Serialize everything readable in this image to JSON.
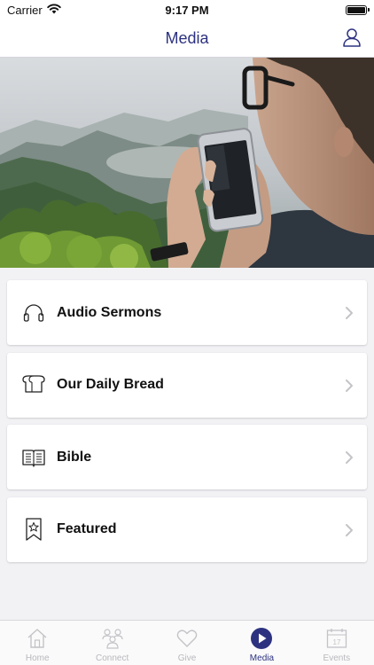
{
  "status_bar": {
    "carrier": "Carrier",
    "time": "9:17 PM"
  },
  "nav": {
    "title": "Media"
  },
  "menu": [
    {
      "label": "Audio Sermons",
      "icon": "headphones-icon"
    },
    {
      "label": "Our Daily Bread",
      "icon": "bread-icon"
    },
    {
      "label": "Bible",
      "icon": "open-book-icon"
    },
    {
      "label": "Featured",
      "icon": "bookmark-star-icon"
    }
  ],
  "tabs": [
    {
      "label": "Home",
      "icon": "house-icon",
      "active": false
    },
    {
      "label": "Connect",
      "icon": "people-icon",
      "active": false
    },
    {
      "label": "Give",
      "icon": "heart-icon",
      "active": false
    },
    {
      "label": "Media",
      "icon": "play-icon",
      "active": true
    },
    {
      "label": "Events",
      "icon": "calendar-icon",
      "active": false
    }
  ],
  "colors": {
    "accent": "#2d3280",
    "inactive": "#b8b8be",
    "background": "#f2f2f5"
  }
}
